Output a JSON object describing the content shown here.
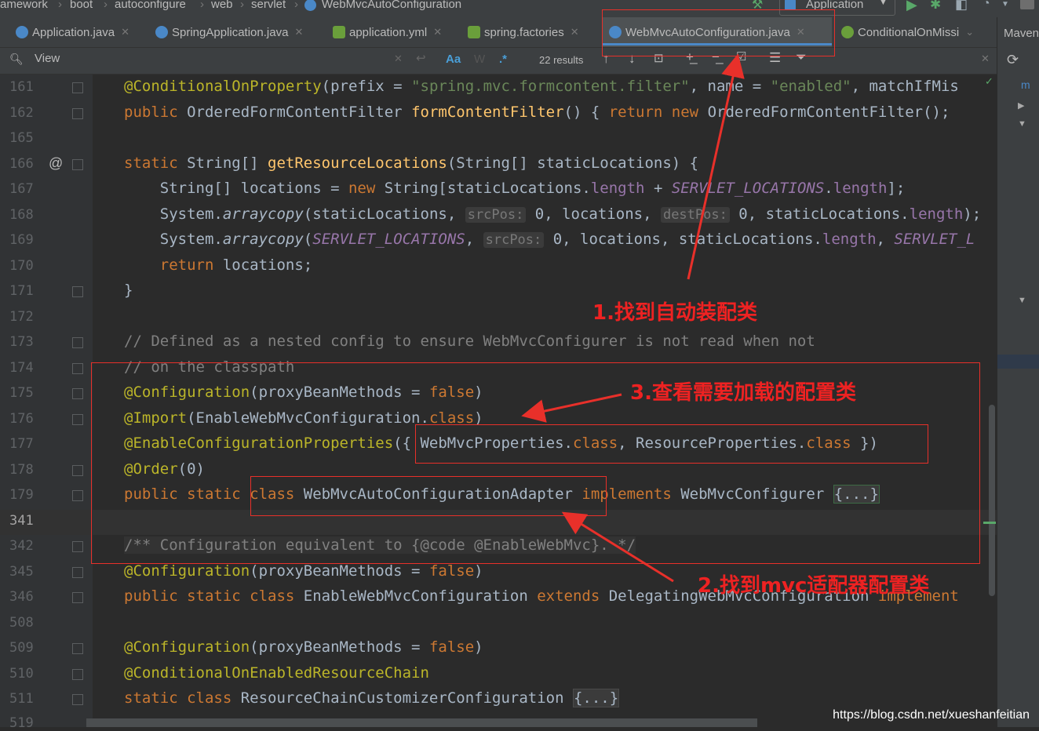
{
  "breadcrumb": [
    "amework",
    "boot",
    "autoconfigure",
    "web",
    "servlet",
    "WebMvcAutoConfiguration"
  ],
  "run_config": "Application",
  "tabs": [
    {
      "label": "Application.java",
      "color": "#4a88c7"
    },
    {
      "label": "SpringApplication.java",
      "color": "#4a88c7"
    },
    {
      "label": "application.yml",
      "color": "#6a9f3b"
    },
    {
      "label": "spring.factories",
      "color": "#6a9f3b"
    },
    {
      "label": "WebMvcAutoConfiguration.java",
      "color": "#4a88c7",
      "active": true
    },
    {
      "label": "ConditionalOnMissi",
      "color": "#6a9f3b"
    }
  ],
  "side_panel_label": "Maven",
  "find": {
    "label": "View",
    "match_case": "Aa",
    "word": "W",
    "regex": ".*",
    "results": "22 results"
  },
  "line_numbers": [
    "161",
    "162",
    "165",
    "166",
    "167",
    "168",
    "169",
    "170",
    "171",
    "172",
    "173",
    "174",
    "175",
    "176",
    "177",
    "178",
    "179",
    "341",
    "342",
    "345",
    "346",
    "508",
    "509",
    "510",
    "511",
    "519"
  ],
  "annotations": {
    "note1": "1.找到自动装配类",
    "note2": "2.找到mvc适配器配置类",
    "note3": "3.查看需要加载的配置类"
  },
  "watermark": "https://blog.csdn.net/xueshanfeitian",
  "code": {
    "l161_a": "@ConditionalOnProperty",
    "l161_b": "(prefix = ",
    "l161_c": "\"spring.mvc.formcontent.filter\"",
    "l161_d": ", name = ",
    "l161_e": "\"enabled\"",
    "l161_f": ", matchIfMis",
    "l162_a": "public ",
    "l162_b": "OrderedFormContentFilter ",
    "l162_c": "formContentFilter",
    "l162_d": "() { ",
    "l162_e": "return new ",
    "l162_f": "OrderedFormContentFilter();",
    "l166_a": "static ",
    "l166_b": "String[] ",
    "l166_c": "getResourceLocations",
    "l166_d": "(String[] staticLocations) {",
    "l167_a": "    String[] locations = ",
    "l167_b": "new ",
    "l167_c": "String[staticLocations.",
    "l167_d": "length",
    "l167_e": " + ",
    "l167_f": "SERVLET_LOCATIONS",
    "l167_g": ".",
    "l167_h": "length",
    "l167_i": "];",
    "l168_a": "    System.",
    "l168_b": "arraycopy",
    "l168_c": "(staticLocations, ",
    "l168_d": "srcPos:",
    "l168_e": " 0, locations, ",
    "l168_f": "destPos:",
    "l168_g": " 0, staticLocations.",
    "l168_h": "length",
    "l168_i": ");",
    "l169_a": "    System.",
    "l169_b": "arraycopy",
    "l169_c": "(",
    "l169_d": "SERVLET_LOCATIONS",
    "l169_e": ", ",
    "l169_f": "srcPos:",
    "l169_g": " 0, locations, staticLocations.",
    "l169_h": "length",
    "l169_i": ", ",
    "l169_j": "SERVLET_L",
    "l170_a": "    ",
    "l170_b": "return ",
    "l170_c": "locations;",
    "l171": "}",
    "l173": "// Defined as a nested config to ensure WebMvcConfigurer is not read when not",
    "l174": "// on the classpath",
    "l175_a": "@Configuration",
    "l175_b": "(proxyBeanMethods = ",
    "l175_c": "false",
    "l175_d": ")",
    "l176_a": "@Import",
    "l176_b": "(EnableWebMvcConfiguration.",
    "l176_c": "class",
    "l176_d": ")",
    "l177_a": "@EnableConfigurationProperties",
    "l177_b": "({ WebMvcProperties.",
    "l177_c": "class",
    "l177_d": ", ResourceProperties.",
    "l177_e": "class",
    "l177_f": " })",
    "l178_a": "@Order",
    "l178_b": "(0)",
    "l179_a": "public static class ",
    "l179_b": "WebMvcAutoConfigurationAdapter ",
    "l179_c": "implements ",
    "l179_d": "WebMvcConfigurer ",
    "l179_e": "{...}",
    "l342": "/** Configuration equivalent to {@code @EnableWebMvc}. */",
    "l345_a": "@Configuration",
    "l345_b": "(proxyBeanMethods = ",
    "l345_c": "false",
    "l345_d": ")",
    "l346_a": "public static class ",
    "l346_b": "EnableWebMvcConfiguration ",
    "l346_c": "extends ",
    "l346_d": "DelegatingWebMvcConfiguration ",
    "l346_e": "implement",
    "l509_a": "@Configuration",
    "l509_b": "(proxyBeanMethods = ",
    "l509_c": "false",
    "l509_d": ")",
    "l510": "@ConditionalOnEnabledResourceChain",
    "l511_a": "static class ",
    "l511_b": "ResourceChainCustomizerConfiguration ",
    "l511_c": "{...}"
  }
}
